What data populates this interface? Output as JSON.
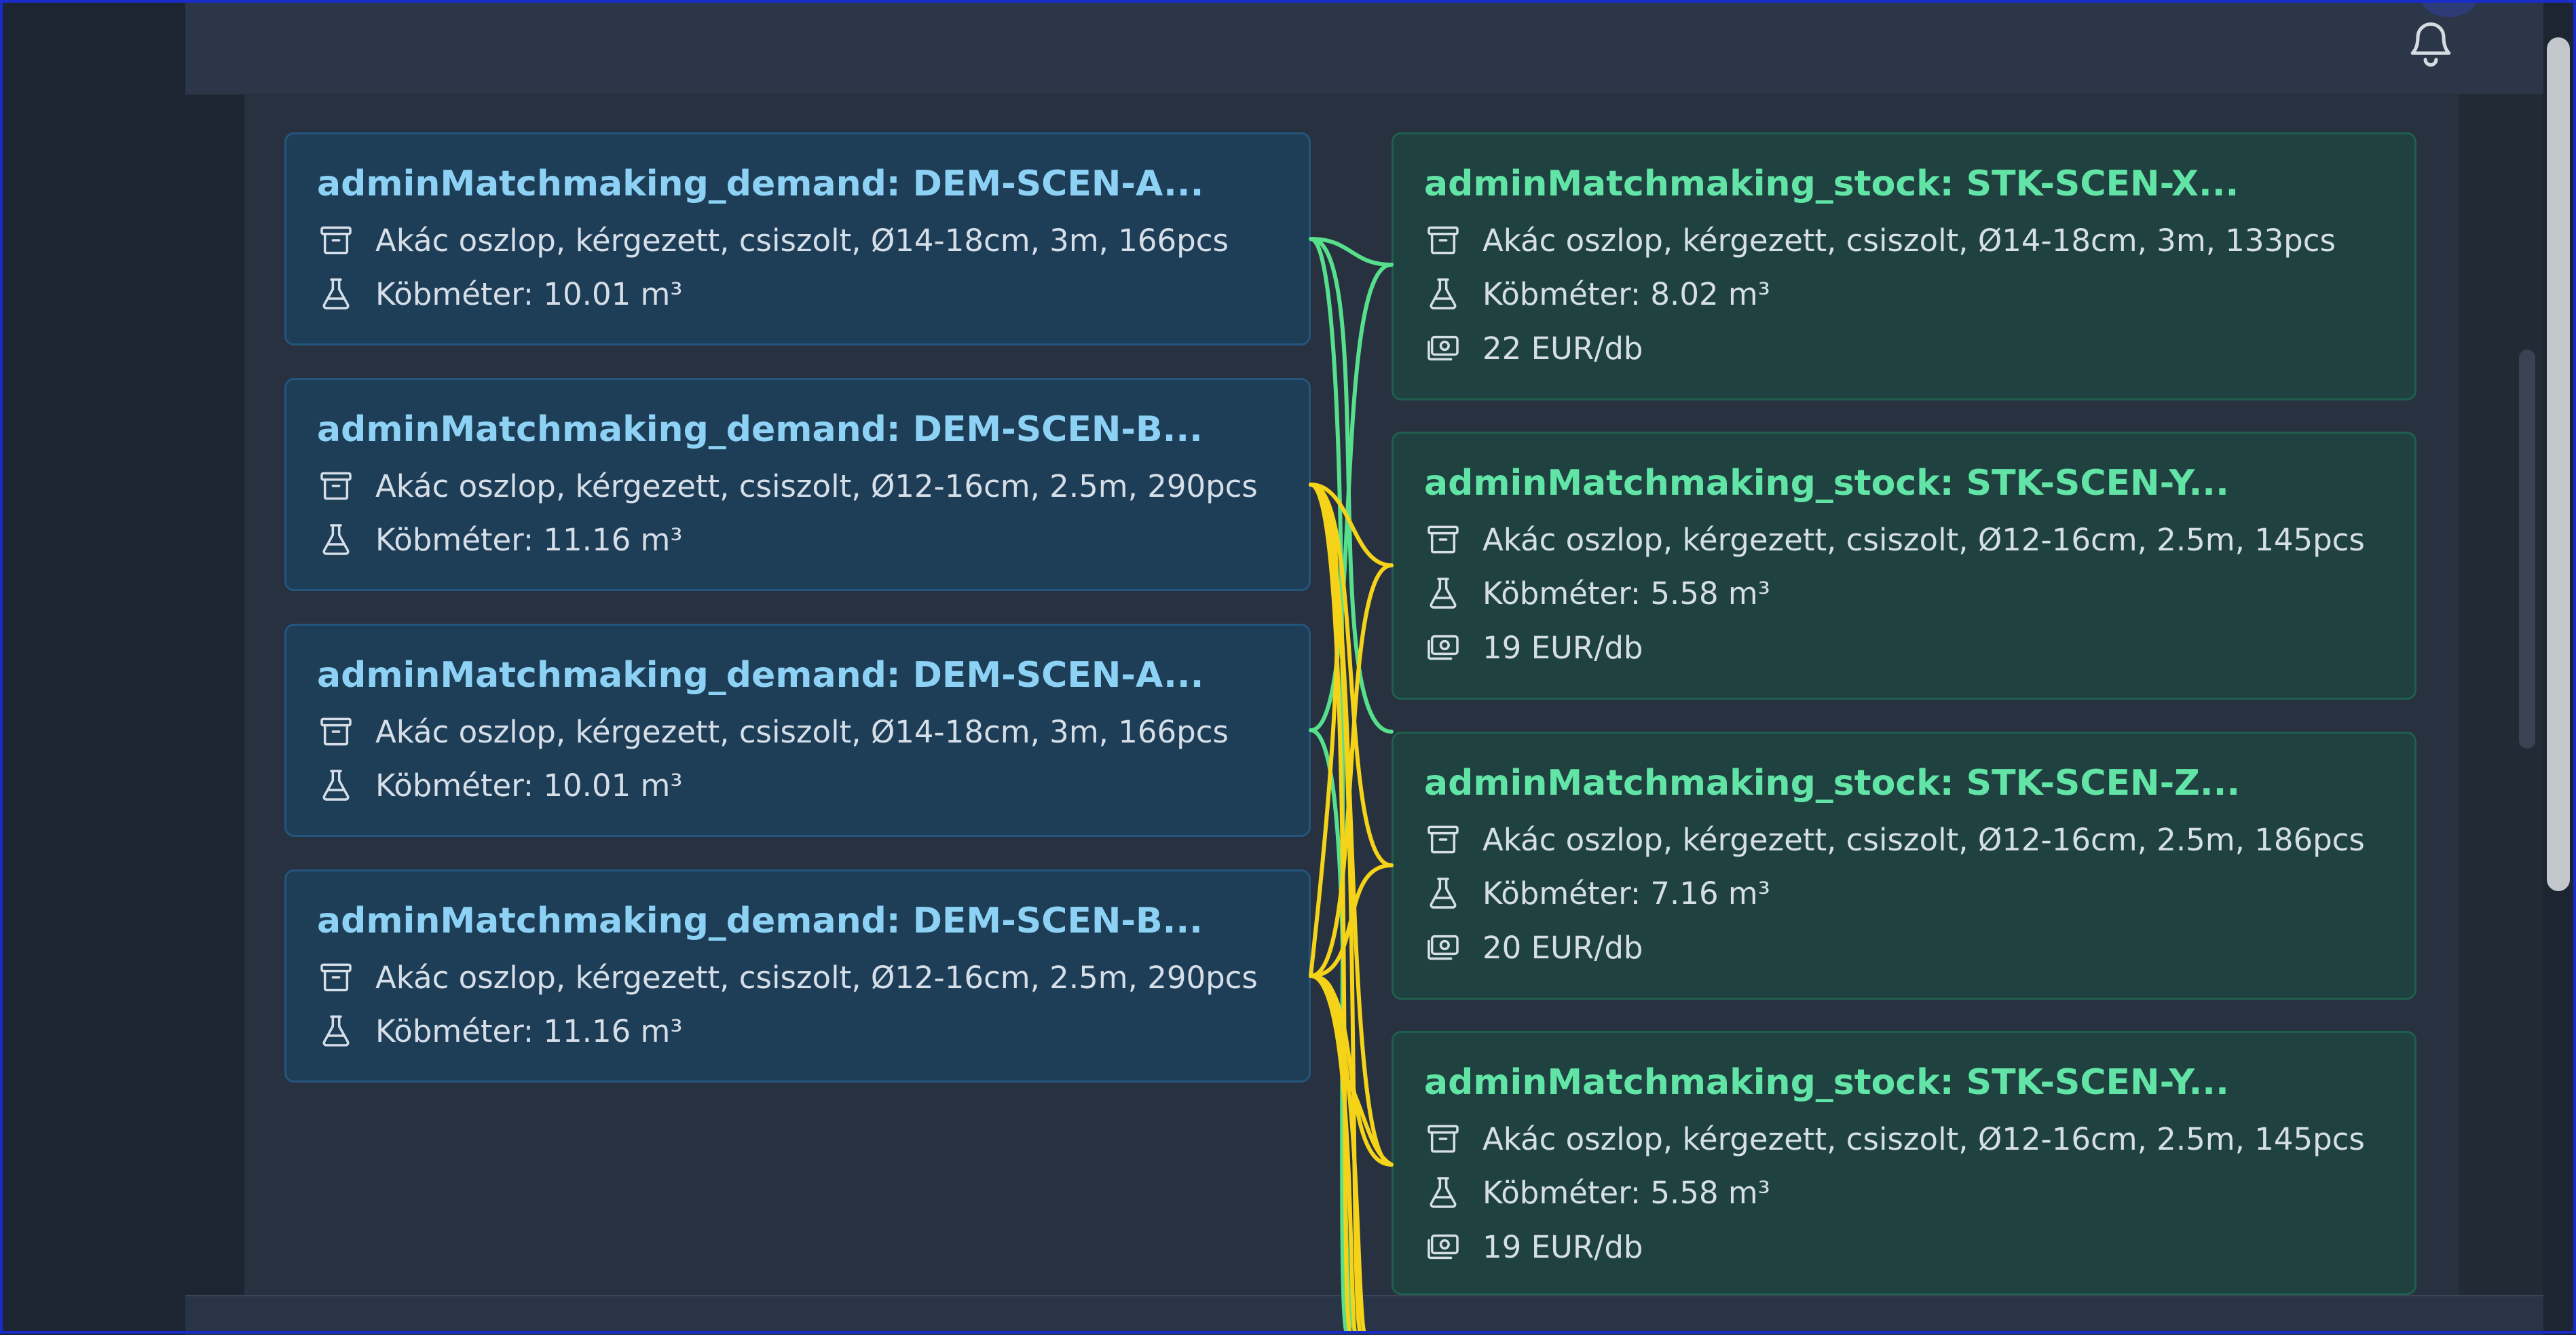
{
  "demands": [
    {
      "title": "adminMatchmaking_demand: DEM-SCEN-A...",
      "product": "Akác oszlop, kérgezett, csiszolt, Ø14-18cm, 3m, 166pcs",
      "volume": "Köbméter: 10.01 m³"
    },
    {
      "title": "adminMatchmaking_demand: DEM-SCEN-B...",
      "product": "Akác oszlop, kérgezett, csiszolt, Ø12-16cm, 2.5m, 290pcs",
      "volume": "Köbméter: 11.16 m³"
    },
    {
      "title": "adminMatchmaking_demand: DEM-SCEN-A...",
      "product": "Akác oszlop, kérgezett, csiszolt, Ø14-18cm, 3m, 166pcs",
      "volume": "Köbméter: 10.01 m³"
    },
    {
      "title": "adminMatchmaking_demand: DEM-SCEN-B...",
      "product": "Akác oszlop, kérgezett, csiszolt, Ø12-16cm, 2.5m, 290pcs",
      "volume": "Köbméter: 11.16 m³"
    }
  ],
  "stocks": [
    {
      "title": "adminMatchmaking_stock: STK-SCEN-X...",
      "product": "Akác oszlop, kérgezett, csiszolt, Ø14-18cm, 3m, 133pcs",
      "volume": "Köbméter: 8.02 m³",
      "price": "22 EUR/db"
    },
    {
      "title": "adminMatchmaking_stock: STK-SCEN-Y...",
      "product": "Akác oszlop, kérgezett, csiszolt, Ø12-16cm, 2.5m, 145pcs",
      "volume": "Köbméter: 5.58 m³",
      "price": "19 EUR/db"
    },
    {
      "title": "adminMatchmaking_stock: STK-SCEN-Z...",
      "product": "Akác oszlop, kérgezett, csiszolt, Ø12-16cm, 2.5m, 186pcs",
      "volume": "Köbméter: 7.16 m³",
      "price": "20 EUR/db"
    },
    {
      "title": "adminMatchmaking_stock: STK-SCEN-Y...",
      "product": "Akác oszlop, kérgezett, csiszolt, Ø12-16cm, 2.5m, 145pcs",
      "volume": "Köbméter: 5.58 m³",
      "price": "19 EUR/db"
    }
  ],
  "icons": {
    "product": "archive-box-icon",
    "volume": "flask-icon",
    "price": "banknote-icon",
    "notifications": "bell-icon"
  },
  "colors": {
    "demand_title": "#8dd2f5",
    "stock_title": "#62e4a6",
    "link_green": "#57e08c",
    "link_yellow": "#f5d319"
  }
}
